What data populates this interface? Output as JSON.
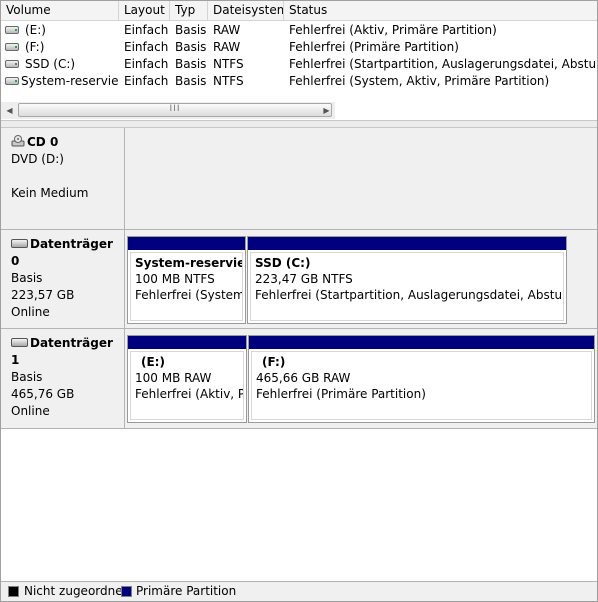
{
  "columns": {
    "volume": "Volume",
    "layout": "Layout",
    "typ": "Typ",
    "dateisystem": "Dateisystem",
    "status": "Status"
  },
  "volumes": [
    {
      "name": "(E:)",
      "layout": "Einfach",
      "typ": "Basis",
      "fs": "RAW",
      "status": "Fehlerfrei (Aktiv, Primäre Partition)"
    },
    {
      "name": "(F:)",
      "layout": "Einfach",
      "typ": "Basis",
      "fs": "RAW",
      "status": "Fehlerfrei (Primäre Partition)"
    },
    {
      "name": "SSD (C:)",
      "layout": "Einfach",
      "typ": "Basis",
      "fs": "NTFS",
      "status": "Fehlerfrei (Startpartition, Auslagerungsdatei, Absturzabbild"
    },
    {
      "name": "System-reserviert",
      "layout": "Einfach",
      "typ": "Basis",
      "fs": "NTFS",
      "status": "Fehlerfrei (System, Aktiv, Primäre Partition)"
    }
  ],
  "scrollbar": {
    "grip": "III"
  },
  "disks": [
    {
      "name": "CD 0",
      "line1": "DVD (D:)",
      "line2": "",
      "line3": "Kein Medium",
      "partitions": []
    },
    {
      "name": "Datenträger 0",
      "line1": "Basis",
      "line2": "223,57 GB",
      "line3": "Online",
      "partitions": [
        {
          "name": "System-reserviert",
          "size": "100 MB NTFS",
          "status": "Fehlerfrei (System, Aktiv, Primäre Partition)"
        },
        {
          "name": "SSD  (C:)",
          "size": "223,47 GB NTFS",
          "status": "Fehlerfrei (Startpartition, Auslagerungsdatei, Absturzabbild, Primäre Partition)"
        }
      ]
    },
    {
      "name": "Datenträger 1",
      "line1": "Basis",
      "line2": "465,76 GB",
      "line3": "Online",
      "partitions": [
        {
          "name": "(E:)",
          "size": "100 MB RAW",
          "status": "Fehlerfrei (Aktiv, Primäre Partition)"
        },
        {
          "name": "(F:)",
          "size": "465,66 GB RAW",
          "status": "Fehlerfrei (Primäre Partition)"
        }
      ]
    }
  ],
  "legend": [
    {
      "label": "Nicht zugeordnet",
      "color": "#000000"
    },
    {
      "label": "Primäre Partition",
      "color": "#00007f"
    }
  ]
}
